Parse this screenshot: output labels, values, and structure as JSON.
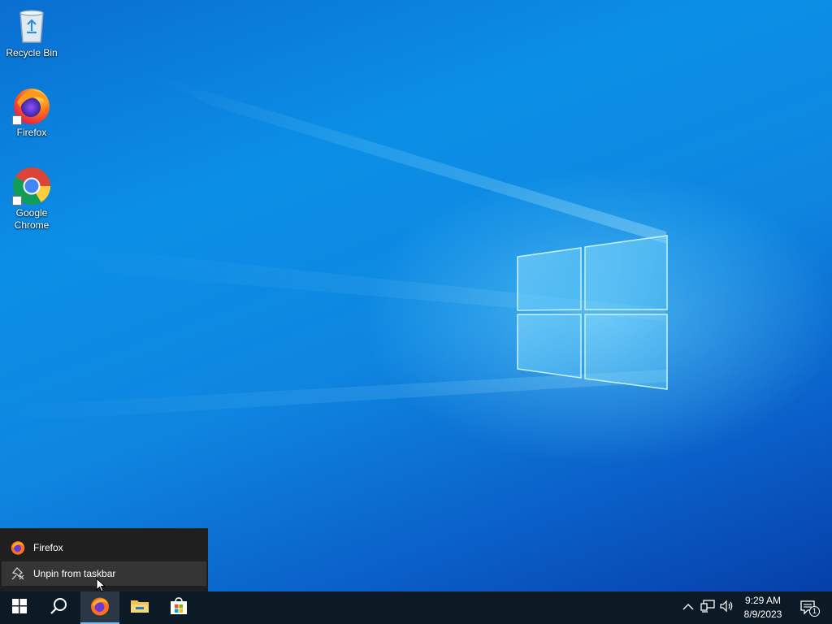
{
  "desktop": {
    "icons": [
      {
        "label": "Recycle Bin",
        "icon": "recycle-bin-icon"
      },
      {
        "label": "Firefox",
        "icon": "firefox-icon"
      },
      {
        "label": "Google Chrome",
        "icon": "chrome-icon"
      }
    ]
  },
  "jumplist": {
    "items": [
      {
        "label": "Firefox",
        "icon": "firefox-icon"
      },
      {
        "label": "Unpin from taskbar",
        "icon": "unpin-icon"
      }
    ]
  },
  "taskbar": {
    "buttons": [
      {
        "name": "start",
        "icon": "windows-icon"
      },
      {
        "name": "search",
        "icon": "search-icon"
      },
      {
        "name": "firefox",
        "icon": "firefox-icon",
        "active": true
      },
      {
        "name": "file-explorer",
        "icon": "folder-icon"
      },
      {
        "name": "microsoft-store",
        "icon": "store-icon"
      }
    ],
    "tray": {
      "icons": [
        "chevron-up-icon",
        "network-icon",
        "volume-icon"
      ],
      "time": "9:29 AM",
      "date": "8/9/2023",
      "notification_count": "1"
    }
  },
  "colors": {
    "taskbar": "#0c1a26",
    "jumplist_bg": "#1f1f1f",
    "jumplist_hover": "#353535",
    "accent": "#76b9ed",
    "desktop_blue": "#0b8fe6"
  }
}
